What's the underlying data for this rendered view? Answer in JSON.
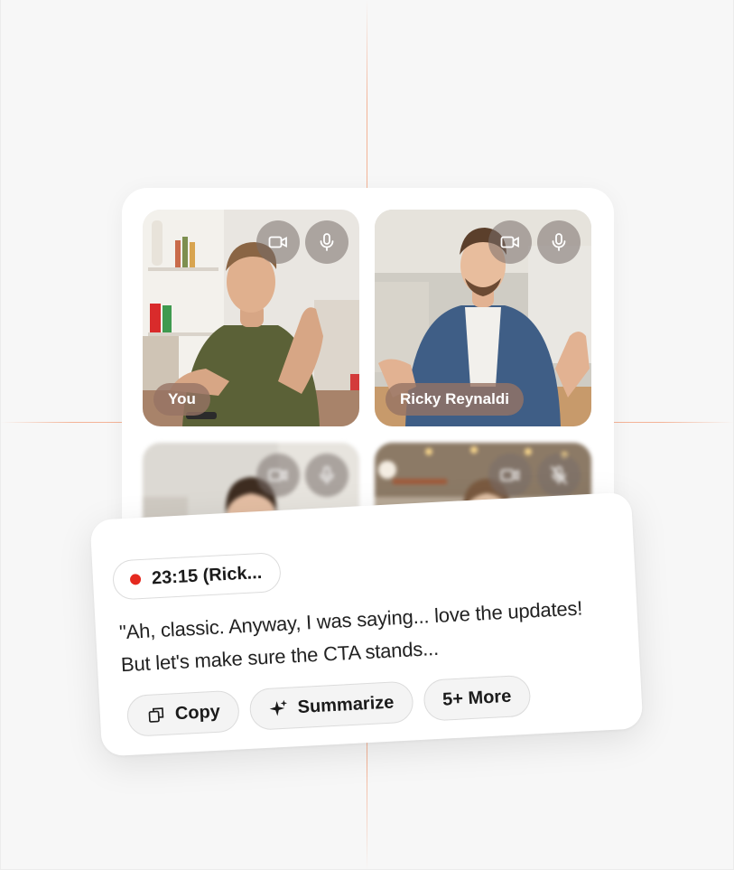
{
  "participants": [
    {
      "name": "You",
      "camera_icon": "video-camera-icon",
      "mic_icon": "microphone-icon"
    },
    {
      "name": "Ricky Reynaldi",
      "camera_icon": "video-camera-icon",
      "mic_icon": "microphone-icon"
    },
    {
      "name": "",
      "camera_icon": "video-camera-icon",
      "mic_icon": "microphone-icon"
    },
    {
      "name": "",
      "camera_icon": "video-camera-icon",
      "mic_icon": "microphone-muted-icon"
    }
  ],
  "transcript": {
    "timestamp_label": "23:15 (Rick...",
    "quote": "\"Ah, classic. Anyway, I was saying... love the updates! But let's make sure the CTA stands...",
    "actions": [
      {
        "label": "Copy",
        "icon": "copy-icon"
      },
      {
        "label": "Summarize",
        "icon": "sparkle-icon"
      },
      {
        "label": "5+ More",
        "icon": ""
      }
    ]
  },
  "colors": {
    "recording": "#e5291f",
    "grid_accent": "#f2966e",
    "control_bg": "#786e69",
    "name_chip_bg": "#96735f"
  }
}
